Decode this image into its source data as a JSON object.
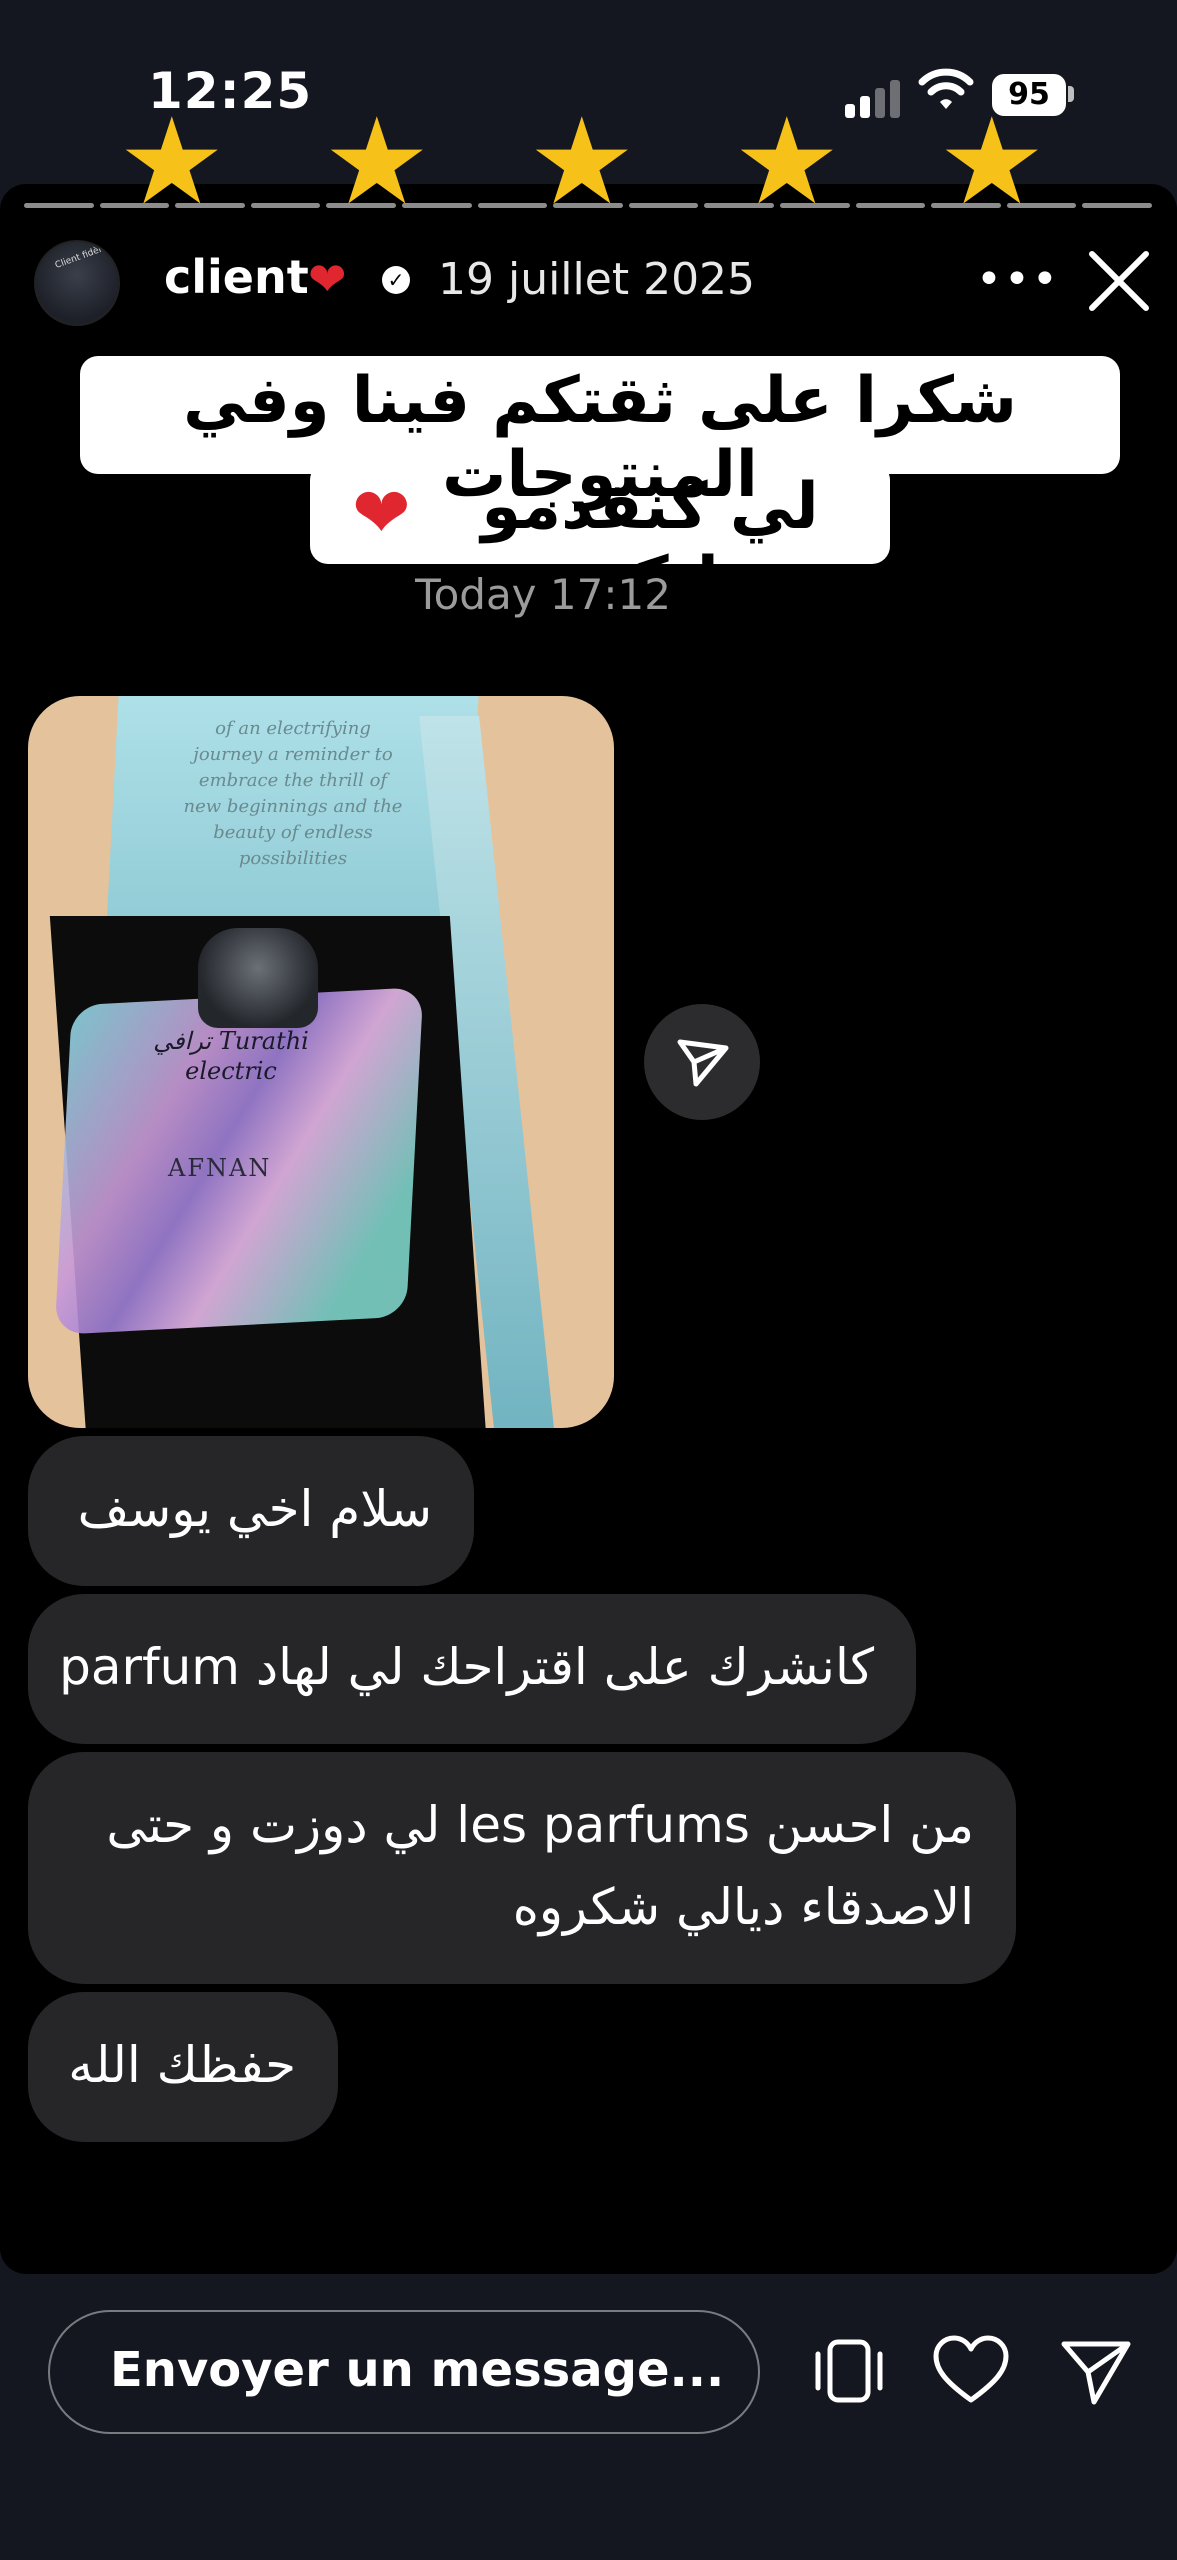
{
  "status_bar": {
    "time": "12:25",
    "battery": "95",
    "icons": [
      "signal-icon",
      "wifi-icon",
      "battery-icon"
    ]
  },
  "rating": {
    "stars": 5,
    "max": 5,
    "color": "#f6c21a"
  },
  "story_header": {
    "username": "client",
    "date": "19 juillet 2025",
    "avatar_text": "Client fidèle",
    "icons": [
      "heart-icon",
      "verified-icon",
      "more-icon",
      "close-icon"
    ]
  },
  "caption": {
    "line1": "شكرا على ثقتكم فينا وفي المنتوجات",
    "line2": "لي كنقدمو ليكم"
  },
  "chat": {
    "timestamp": "Today 17:12",
    "photo": {
      "lid_text": "of an electrifying journey a reminder to embrace the thrill of new beginnings and the beauty of endless possibilities",
      "bottle_text": "ترافي Turathi electric",
      "brand": "AFNAN"
    },
    "messages": [
      {
        "lines": [
          "سلام اخي يوسف"
        ]
      },
      {
        "lines": [
          "كانشرك على اقتراحك لي لهاد parfum"
        ]
      },
      {
        "lines": [
          "من احسن les parfums لي دوزت و حتى",
          "الاصدقاء ديالي شكروه"
        ]
      },
      {
        "lines": [
          "حفظك الله"
        ]
      }
    ]
  },
  "composer": {
    "placeholder": "Envoyer un message...",
    "icons": [
      "sticker-icon",
      "like-heart-icon",
      "send-icon"
    ]
  },
  "colors": {
    "background": "#141620",
    "story_bg": "#000000",
    "bubble": "#262628",
    "heart": "#e0262f"
  }
}
